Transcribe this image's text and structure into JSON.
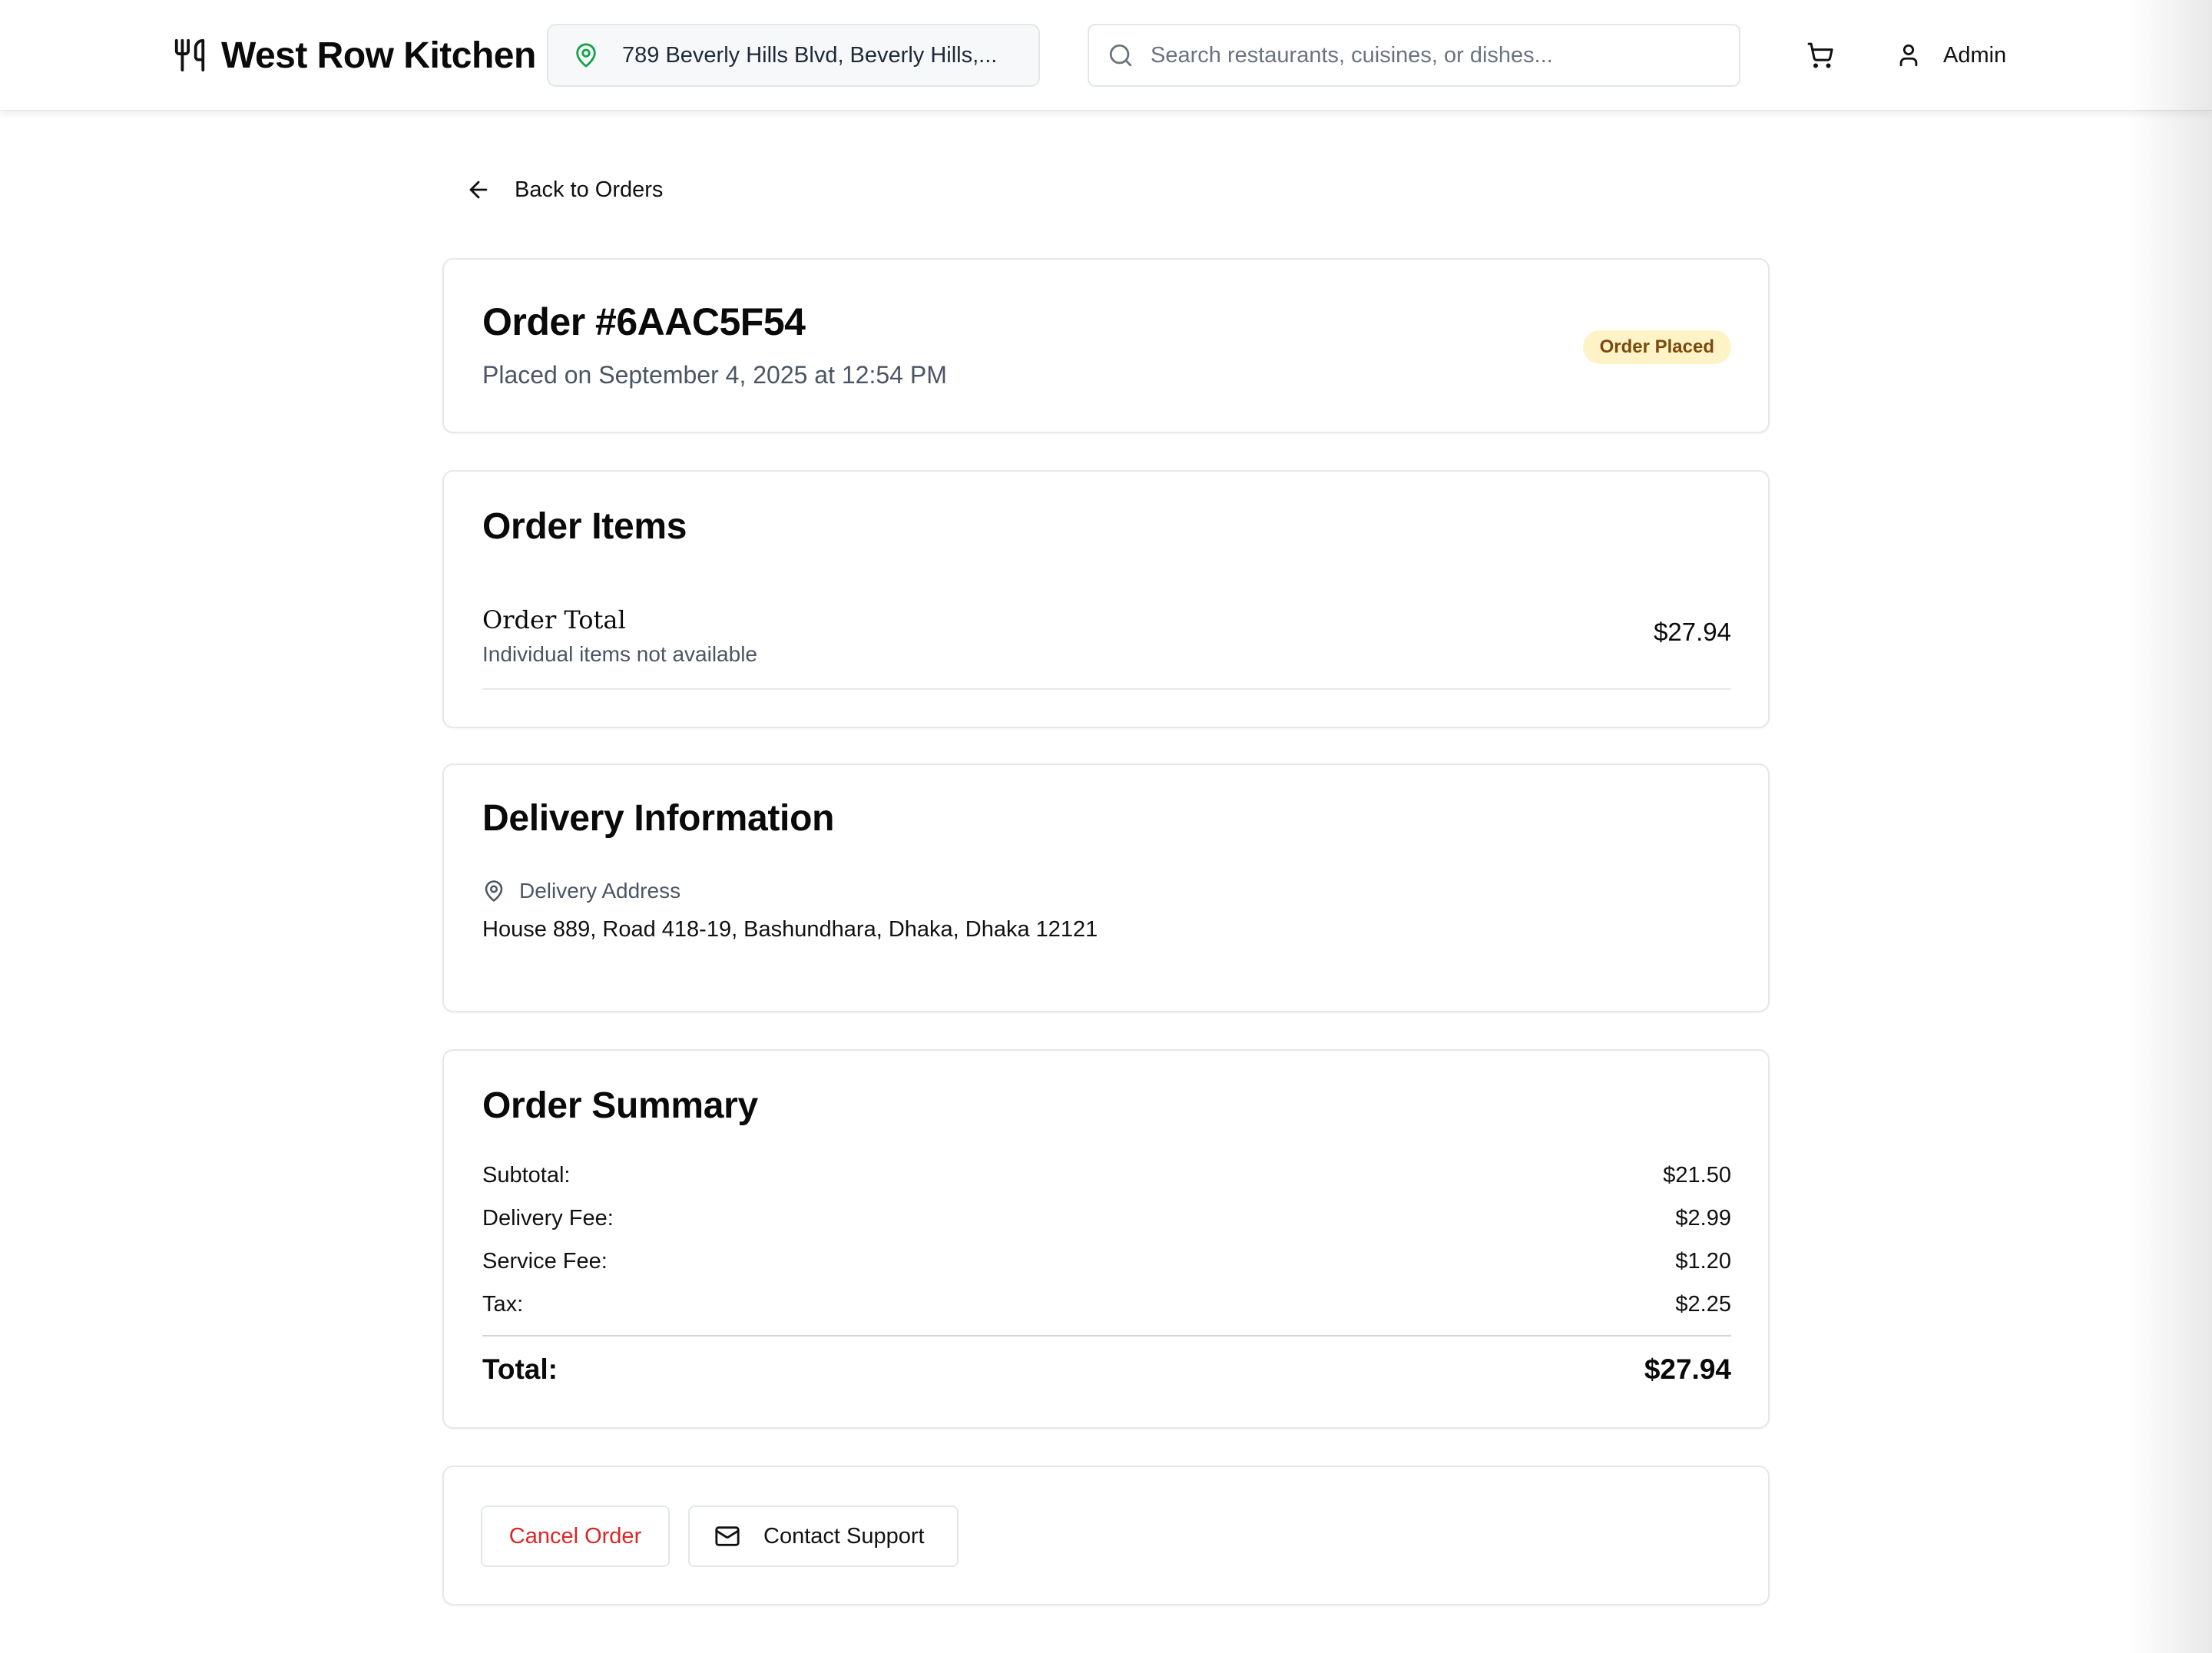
{
  "header": {
    "brand": "West Row Kitchen",
    "location": "789 Beverly Hills Blvd, Beverly Hills,...",
    "search_placeholder": "Search restaurants, cuisines, or dishes...",
    "user_label": "Admin"
  },
  "nav": {
    "back_label": "Back to Orders"
  },
  "order": {
    "title": "Order #6AAC5F54",
    "placed": "Placed on September 4, 2025 at 12:54 PM",
    "status": "Order Placed"
  },
  "items_section": {
    "title": "Order Items",
    "line_name": "Order Total",
    "line_note": "Individual items not available",
    "line_price": "$27.94"
  },
  "delivery": {
    "title": "Delivery Information",
    "address_label": "Delivery Address",
    "address": "House 889, Road 418-19, Bashundhara, Dhaka, Dhaka 12121"
  },
  "summary": {
    "title": "Order Summary",
    "rows": [
      {
        "label": "Subtotal:",
        "value": "$21.50"
      },
      {
        "label": "Delivery Fee:",
        "value": "$2.99"
      },
      {
        "label": "Service Fee:",
        "value": "$1.20"
      },
      {
        "label": "Tax:",
        "value": "$2.25"
      }
    ],
    "total_label": "Total:",
    "total_value": "$27.94"
  },
  "actions": {
    "cancel_label": "Cancel Order",
    "support_label": "Contact Support"
  },
  "colors": {
    "location_pin": "#16a34a",
    "status_badge_bg": "#fef3c7",
    "status_badge_text": "#7a4a0e",
    "cancel_text": "#dc2626"
  },
  "icons": {
    "logo": "utensils-icon",
    "location": "map-pin-icon",
    "search": "search-icon",
    "cart": "shopping-cart-icon",
    "user": "user-icon",
    "back": "arrow-left-icon",
    "address": "map-pin-icon",
    "support": "mail-icon"
  }
}
